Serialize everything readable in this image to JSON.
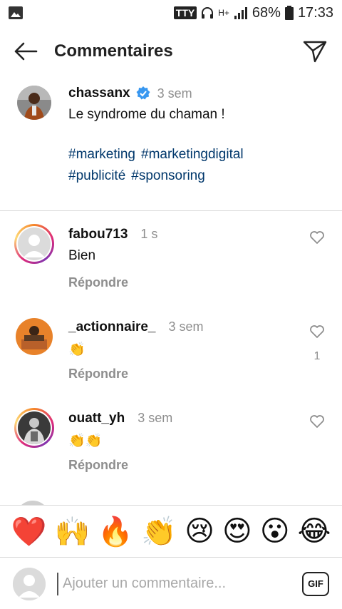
{
  "status": {
    "tty": "TTY",
    "network": "H+",
    "battery": "68%",
    "time": "17:33"
  },
  "header": {
    "title": "Commentaires"
  },
  "caption": {
    "user": "chassanx",
    "time": "3 sem",
    "text": "Le syndrome du chaman !",
    "hashtags": [
      "#marketing",
      "#marketingdigital",
      "#publicité",
      "#sponsoring"
    ]
  },
  "comments": [
    {
      "user": "fabou713",
      "time": "1 s",
      "text": "Bien",
      "reply": "Répondre",
      "likes": ""
    },
    {
      "user": "_actionnaire_",
      "time": "3 sem",
      "text": "👏",
      "reply": "Répondre",
      "likes": "1"
    },
    {
      "user": "ouatt_yh",
      "time": "3 sem",
      "text": "👏👏",
      "reply": "Répondre",
      "likes": ""
    }
  ],
  "emoji_bar": [
    "❤️",
    "🙌",
    "🔥",
    "👏",
    "😢",
    "😍",
    "😮",
    "😂"
  ],
  "input": {
    "placeholder": "Ajouter un commentaire...",
    "gif_label": "GIF"
  },
  "colors": {
    "hashtag": "#00376b",
    "muted": "#8e8e8e",
    "verified": "#3897f0"
  }
}
